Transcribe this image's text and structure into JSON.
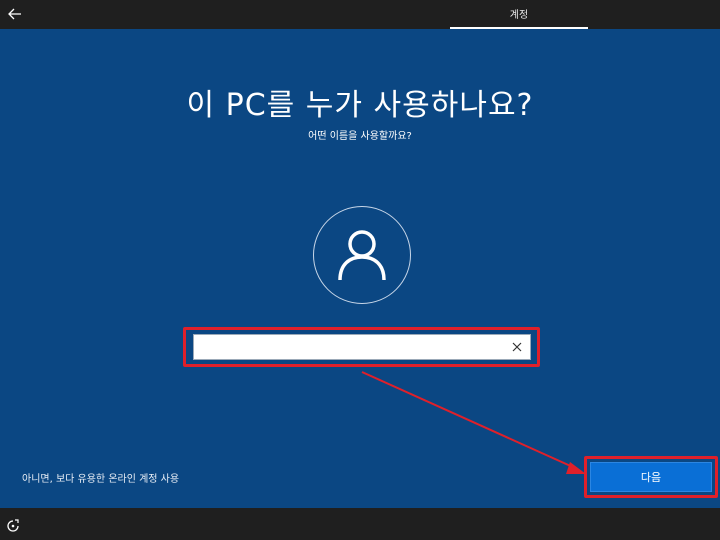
{
  "header": {
    "tab_label": "계정"
  },
  "main": {
    "title": "이 PC를 누가 사용하나요?",
    "subtitle": "어떤 이름을 사용할까요?",
    "name_input_value": "",
    "name_input_placeholder": ""
  },
  "footer": {
    "alternative_link": "아니면, 보다 유용한 온라인 계정 사용",
    "next_label": "다음"
  },
  "icons": {
    "back": "back-arrow-icon",
    "avatar": "user-icon",
    "clear": "close-icon",
    "accessibility": "accessibility-icon"
  },
  "colors": {
    "background": "#0b4783",
    "bar": "#1f1f1f",
    "accent": "#0a6fd6",
    "highlight": "#e0202a"
  }
}
